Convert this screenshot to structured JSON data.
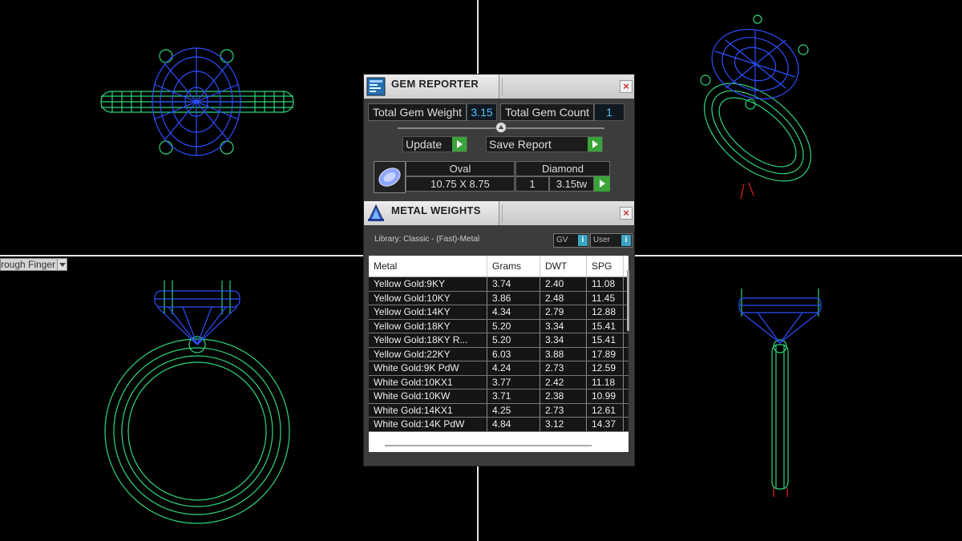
{
  "viewport": {
    "label": "rough Finger"
  },
  "gem_reporter": {
    "title": "GEM REPORTER",
    "total_gem_weight_label": "Total Gem Weight",
    "total_gem_weight": "3.15",
    "total_gem_count_label": "Total Gem Count",
    "total_gem_count": "1",
    "update_label": "Update",
    "save_report_label": "Save Report",
    "gem": {
      "shape": "Oval",
      "size": "10.75 X 8.75",
      "type": "Diamond",
      "count": "1",
      "weight": "3.15tw"
    }
  },
  "metal_weights": {
    "title": "METAL WEIGHTS",
    "library": "Library: Classic - (Fast)-Metal",
    "toggle_gv": "GV",
    "toggle_user": "User",
    "toggle_icon": "i",
    "columns": [
      "Metal",
      "Grams",
      "DWT",
      "SPG"
    ],
    "rows": [
      [
        "Yellow Gold:9KY",
        "3.74",
        "2.40",
        "11.08"
      ],
      [
        "Yellow Gold:10KY",
        "3.86",
        "2.48",
        "11.45"
      ],
      [
        "Yellow Gold:14KY",
        "4.34",
        "2.79",
        "12.88"
      ],
      [
        "Yellow Gold:18KY",
        "5.20",
        "3.34",
        "15.41"
      ],
      [
        "Yellow Gold:18KY R...",
        "5.20",
        "3.34",
        "15.41"
      ],
      [
        "Yellow Gold:22KY",
        "6.03",
        "3.88",
        "17.89"
      ],
      [
        "White Gold:9K PdW",
        "4.24",
        "2.73",
        "12.59"
      ],
      [
        "White Gold:10KX1",
        "3.77",
        "2.42",
        "11.18"
      ],
      [
        "White Gold:10KW",
        "3.71",
        "2.38",
        "10.99"
      ],
      [
        "White Gold:14KX1",
        "4.25",
        "2.73",
        "12.61"
      ],
      [
        "White Gold:14K PdW",
        "4.84",
        "3.12",
        "14.37"
      ]
    ]
  },
  "colors": {
    "wire_green": "#2fd67a",
    "wire_blue": "#2d4fff",
    "value_cyan": "#4fc3ff",
    "play_green": "#3aa33a"
  },
  "icons": [
    "gem-reporter-icon",
    "metal-weights-icon",
    "close-icon",
    "play-icon",
    "slider-knob-icon",
    "info-icon",
    "chevron-down-icon"
  ]
}
